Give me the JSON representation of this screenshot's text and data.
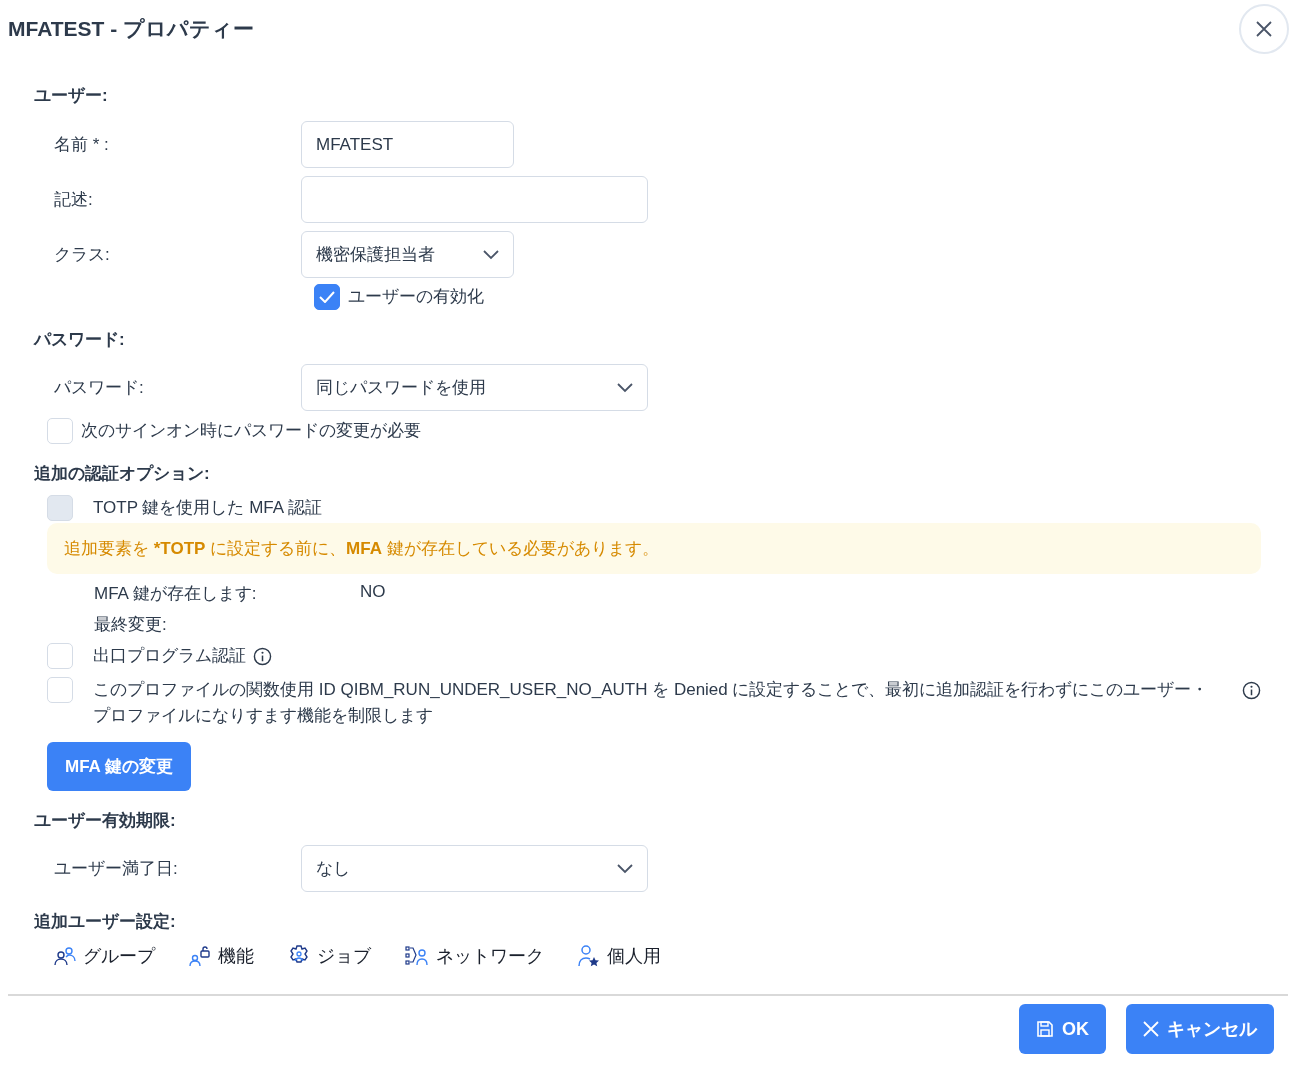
{
  "title": "MFATEST - プロパティー",
  "user": {
    "heading": "ユーザー:",
    "fields": [
      {
        "label": "名前 * :",
        "kind": "text",
        "value": "MFATEST"
      },
      {
        "label": "記述:",
        "kind": "text"
      },
      {
        "label": "クラス:",
        "kind": "select",
        "value": "機密保護担当者"
      }
    ],
    "enable": {
      "label": "ユーザーの有効化",
      "checked": true
    }
  },
  "password": {
    "heading": "パスワード:",
    "field": {
      "label": "パスワード:",
      "kind": "select",
      "value": "同じパスワードを使用"
    },
    "change_required": {
      "label": "次のサインオン時にパスワードの変更が必要",
      "checked": false
    }
  },
  "auth": {
    "heading": "追加の認証オプション:",
    "totp": {
      "label": "TOTP 鍵を使用した MFA 認証",
      "checked": false,
      "disabled": true
    },
    "warning": "追加要素を ***TOTP** に設定する前に、**MFA** 鍵が存在している必要があります。",
    "info": [
      {
        "label": "MFA 鍵が存在します:",
        "value": "NO"
      },
      {
        "label": "最終変更:"
      }
    ],
    "exit_program": {
      "label": "出口プログラム認証",
      "checked": false
    },
    "restrict": {
      "label": "このプロファイルの関数使用 ID QIBM_RUN_UNDER_USER_NO_AUTH を Denied に設定することで、最初に追加認証を行わずにこのユーザー・プロファイルになりすます機能を制限します",
      "checked": false
    },
    "button": "MFA 鍵の変更"
  },
  "expiry": {
    "heading": "ユーザー有効期限:",
    "field": {
      "label": "ユーザー満了日:",
      "kind": "select",
      "value": "なし"
    }
  },
  "extra": {
    "heading": "追加ユーザー設定:",
    "links": [
      {
        "label": "グループ",
        "kind": "group"
      },
      {
        "label": "機能",
        "kind": "function"
      },
      {
        "label": "ジョブ",
        "kind": "job"
      },
      {
        "label": "ネットワーク",
        "kind": "network"
      },
      {
        "label": "個人用",
        "kind": "personal"
      }
    ]
  },
  "footer": {
    "ok": "OK",
    "cancel": "キャンセル"
  }
}
